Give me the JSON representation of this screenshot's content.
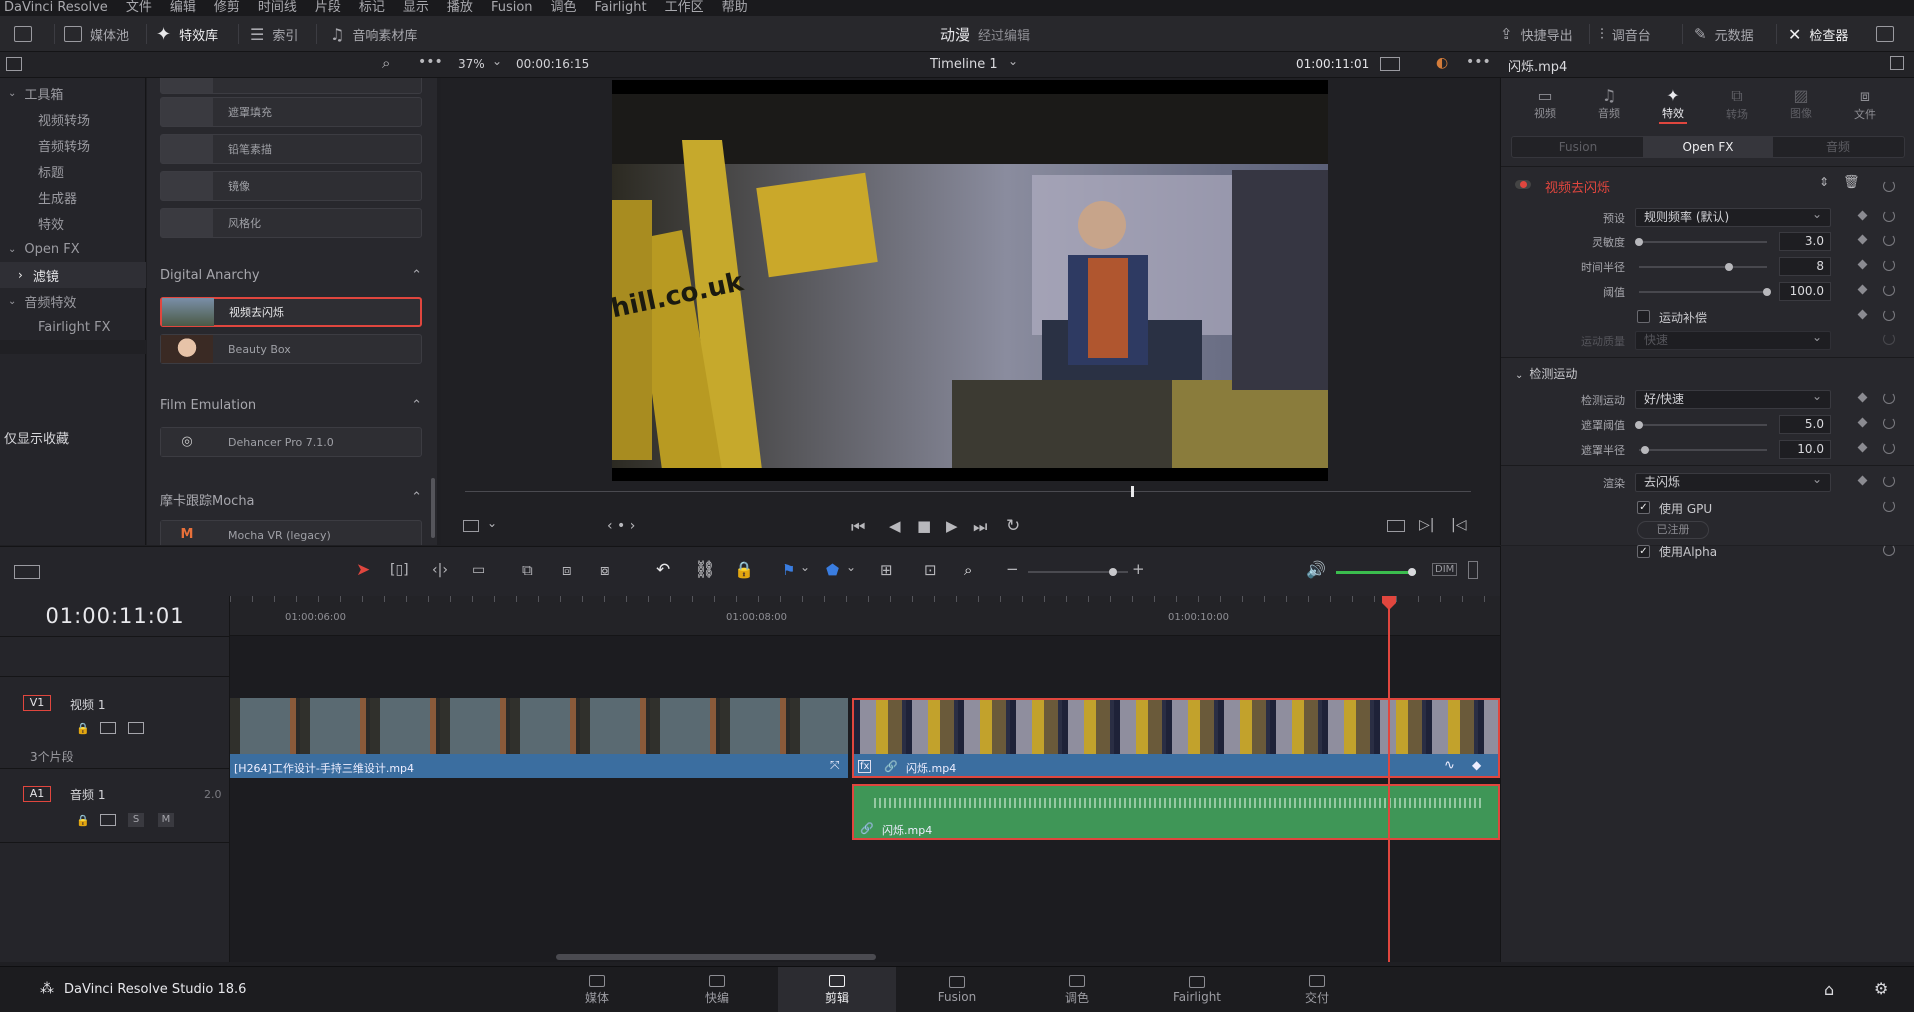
{
  "menu": [
    "DaVinci Resolve",
    "文件",
    "编辑",
    "修剪",
    "时间线",
    "片段",
    "标记",
    "显示",
    "播放",
    "Fusion",
    "调色",
    "Fairlight",
    "工作区",
    "帮助"
  ],
  "toolbar": {
    "media_pool": "媒体池",
    "effects": "特效库",
    "index": "索引",
    "sound_library": "音响素材库",
    "center_title": "动漫",
    "center_subtitle": "经过编辑",
    "quick_export": "快捷导出",
    "mixer": "调音台",
    "metadata": "元数据",
    "inspector": "检查器"
  },
  "viewer": {
    "zoom": "37%",
    "timecode": "00:00:16:15",
    "timeline_name": "Timeline 1",
    "current_tc": "01:00:11:01"
  },
  "left_tree": {
    "items": [
      {
        "label": "工具箱",
        "level": 0,
        "expanded": true
      },
      {
        "label": "视频转场",
        "level": 1
      },
      {
        "label": "音频转场",
        "level": 1
      },
      {
        "label": "标题",
        "level": 1
      },
      {
        "label": "生成器",
        "level": 1
      },
      {
        "label": "特效",
        "level": 1
      },
      {
        "label": "Open FX",
        "level": 0,
        "expanded": true
      },
      {
        "label": "滤镜",
        "level": 1,
        "selected": true
      },
      {
        "label": "音频特效",
        "level": 0,
        "expanded": true
      },
      {
        "label": "Fairlight FX",
        "level": 1
      }
    ],
    "favorites_only": "仅显示收藏"
  },
  "fx_list": {
    "top_items": [
      "遮罩填充",
      "铅笔素描",
      "镜像",
      "风格化"
    ],
    "groups": [
      {
        "name": "Digital Anarchy",
        "items": [
          {
            "label": "视频去闪烁",
            "selected": true
          },
          {
            "label": "Beauty Box"
          }
        ]
      },
      {
        "name": "Film Emulation",
        "items": [
          {
            "label": "Dehancer Pro 7.1.0"
          }
        ]
      },
      {
        "name": "摩卡跟踪Mocha",
        "items": [
          {
            "label": "Mocha VR (legacy)"
          }
        ]
      }
    ]
  },
  "inspector": {
    "clip_name": "闪烁.mp4",
    "tabs": [
      "视频",
      "音频",
      "特效",
      "转场",
      "图像",
      "文件"
    ],
    "active_tab": "特效",
    "subtabs": [
      "Fusion",
      "Open FX",
      "音频"
    ],
    "active_subtab": "Open FX",
    "effect_name": "视频去闪烁",
    "preset_label": "预设",
    "preset_value": "规则频率 (默认)",
    "sensitivity_label": "灵敏度",
    "sensitivity_value": "3.0",
    "sensitivity_fraction": 0.0,
    "time_radius_label": "时间半径",
    "time_radius_value": "8",
    "time_radius_fraction": 0.7,
    "threshold_label": "阈值",
    "threshold_value": "100.0",
    "threshold_fraction": 1.0,
    "motion_comp_label": "运动补偿",
    "motion_quality_label": "运动质量",
    "motion_quality_value": "快速",
    "detect_section": "检测运动",
    "detect_label": "检测运动",
    "detect_value": "好/快速",
    "mask_threshold_label": "遮罩阈值",
    "mask_threshold_value": "5.0",
    "mask_threshold_fraction": 0.0,
    "mask_radius_label": "遮罩半径",
    "mask_radius_value": "10.0",
    "mask_radius_fraction": 0.05,
    "render_label": "渲染",
    "render_value": "去闪烁",
    "use_gpu": "使用 GPU",
    "registered": "已注册",
    "use_alpha": "使用Alpha"
  },
  "timeline": {
    "timecode": "01:00:11:01",
    "ruler_labels": [
      "01:00:06:00",
      "01:00:08:00",
      "01:00:10:00"
    ],
    "v1_badge": "V1",
    "v1_name": "视频 1",
    "v1_count": "3个片段",
    "a1_badge": "A1",
    "a1_name": "音频 1",
    "a1_level": "2.0",
    "solo": "S",
    "mute": "M",
    "clip1_name": "[H264]工作设计-手持三维设计.mp4",
    "clip2_name": "闪烁.mp4",
    "audio_clip_name": "闪烁.mp4",
    "zoom_level_fraction": 0.85,
    "volume_fraction": 0.95,
    "dim": "DIM"
  },
  "bottom": {
    "app_name": "DaVinci Resolve Studio 18.6",
    "pages": [
      "媒体",
      "快编",
      "剪辑",
      "Fusion",
      "调色",
      "Fairlight",
      "交付"
    ],
    "active_page": "剪辑"
  },
  "colors": {
    "accent_red": "#e0463e",
    "video_blue": "#4a82b8",
    "audio_green": "#4a9a5e"
  }
}
